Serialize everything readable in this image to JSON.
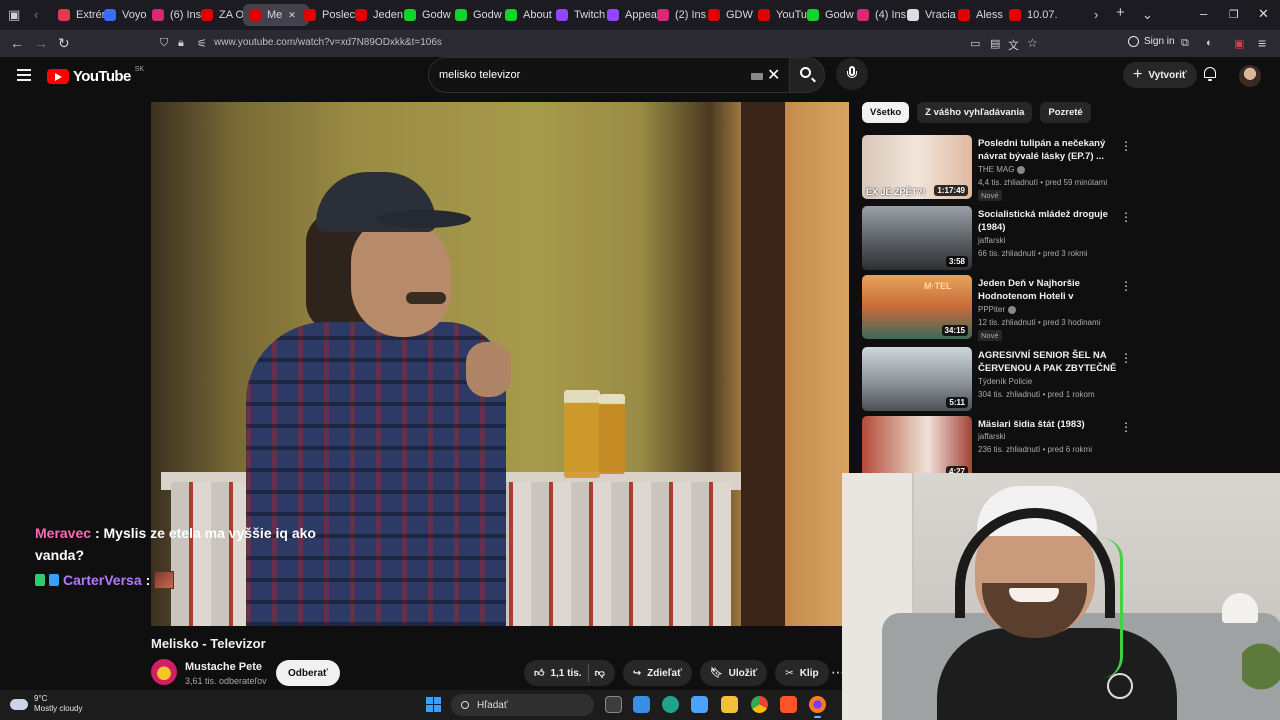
{
  "browser": {
    "tabs": [
      {
        "label": "Extrén",
        "color": "#e23b50"
      },
      {
        "label": "Voyo",
        "color": "#3b6cff"
      },
      {
        "label": "(6) Ins",
        "color": "#d62976"
      },
      {
        "label": "ZA OF",
        "color": "#e00000"
      },
      {
        "label": "Me",
        "color": "#e00000",
        "active": true
      },
      {
        "label": "Poslec",
        "color": "#e00000"
      },
      {
        "label": "Jeden",
        "color": "#e00000"
      },
      {
        "label": "Godw",
        "color": "#14d22b"
      },
      {
        "label": "Godw",
        "color": "#14d22b"
      },
      {
        "label": "About",
        "color": "#14d22b"
      },
      {
        "label": "Twitch",
        "color": "#9146ff"
      },
      {
        "label": "Appea",
        "color": "#9146ff"
      },
      {
        "label": "(2) Ins",
        "color": "#d62976"
      },
      {
        "label": "GDW",
        "color": "#e00000"
      },
      {
        "label": "YouTu",
        "color": "#e00000"
      },
      {
        "label": "Godw",
        "color": "#14d22b"
      },
      {
        "label": "(4) Ins",
        "color": "#d62976"
      },
      {
        "label": "Vracia",
        "color": "#dddddd"
      },
      {
        "label": "Aless",
        "color": "#e00000"
      },
      {
        "label": "10.07.",
        "color": "#e00000"
      }
    ],
    "url": "www.youtube.com/watch?v=xd7N89ODxkk&t=106s",
    "sign_in": "Sign in"
  },
  "youtube": {
    "logo_text": "YouTube",
    "country_code": "SK",
    "search_query": "melisko televizor",
    "create_label": "Vytvoriť"
  },
  "chat": {
    "line1_user": "Meravec",
    "line1_text": ": Myslis ze etela ma vyššie iq ako vanda?",
    "line2_user": "CarterVersa",
    "line2_text": ":"
  },
  "video": {
    "title": "Melisko - Televizor",
    "channel": "Mustache Pete",
    "subscribers": "3,61 tis. odberateľov",
    "subscribe_label": "Odberať",
    "likes": "1,1 tis.",
    "share_label": "Zdieľať",
    "save_label": "Uložiť",
    "clip_label": "Klip"
  },
  "chips": [
    "Všetko",
    "Z vášho vyhľadávania",
    "Pozreté"
  ],
  "recommendations": [
    {
      "title": "Posledni tulipán a nečekaný návrat bývalé lásky (EP.7) ...",
      "channel": "THE MAG",
      "verified": true,
      "meta": "4,4 tis. zhliadnutí • pred 59 minútami",
      "badge": "Nové",
      "duration": "1:17:49",
      "thumb_text": "EX JE ZPĚT?!"
    },
    {
      "title": "Socialistická mládež droguje (1984)",
      "channel": "jaffarski",
      "verified": false,
      "meta": "66 tis. zhliadnutí • pred 3 rokmi",
      "badge": "",
      "duration": "3:58",
      "thumb_text": ""
    },
    {
      "title": "Jeden Deň v Najhoršie Hodnotenom Hoteli v Kalifornii...",
      "channel": "PPPiter",
      "verified": true,
      "meta": "12 tis. zhliadnutí • pred 3 hodinami",
      "badge": "Nové",
      "duration": "34:15",
      "thumb_text": "M·TEL"
    },
    {
      "title": "AGRESIVNÍ SENIOR ŠEL NA ČERVENOU A PAK ZBYTEČNĚ ...",
      "channel": "Týdeník Policie",
      "verified": false,
      "meta": "304 tis. zhliadnutí • pred 1 rokom",
      "badge": "",
      "duration": "5:11",
      "thumb_text": ""
    },
    {
      "title": "Mäsiari šidia štát (1983)",
      "channel": "jaffarski",
      "verified": false,
      "meta": "236 tis. zhliadnutí • pred 6 rokmi",
      "badge": "",
      "duration": "4:27",
      "thumb_text": ""
    }
  ],
  "taskbar": {
    "temperature": "9°C",
    "weather": "Mostly cloudy",
    "search_placeholder": "Hľadať"
  }
}
